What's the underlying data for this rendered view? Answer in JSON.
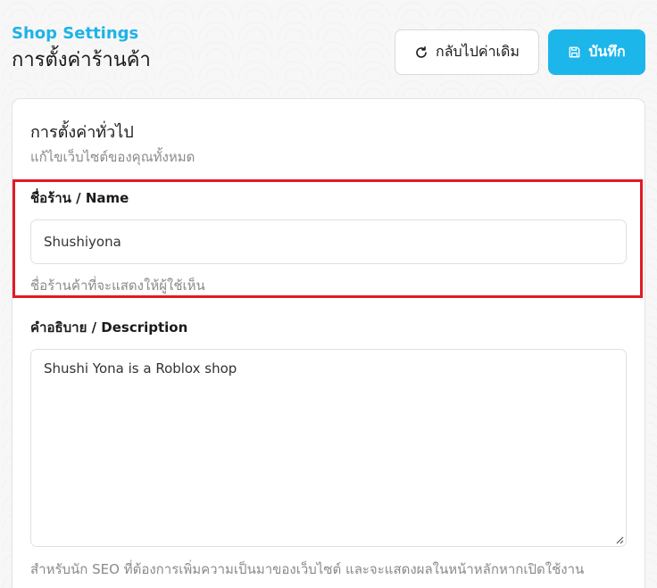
{
  "header": {
    "eyebrow": "Shop Settings",
    "title": "การตั้งค่าร้านค้า"
  },
  "actions": {
    "reset_label": "กลับไปค่าเดิม",
    "save_label": "บันทึก",
    "reset_icon": "refresh-icon",
    "save_icon": "save-icon"
  },
  "card": {
    "title": "การตั้งค่าทั่วไป",
    "subtitle": "แก้ไขเว็บไซต์ของคุณทั้งหมด"
  },
  "fields": {
    "name": {
      "label": "ชื่อร้าน / Name",
      "value": "Shushiyona",
      "help": "ชื่อร้านค้าที่จะแสดงให้ผู้ใช้เห็น"
    },
    "description": {
      "label": "คำอธิบาย / Description",
      "value": "Shushi Yona is a Roblox shop",
      "help": "สำหรับนัก SEO ที่ต้องการเพิ่มความเป็นมาของเว็บไซต์ และจะแสดงผลในหน้าหลักหากเปิดใช้งาน"
    }
  },
  "colors": {
    "accent": "#1cb6ea",
    "highlight": "#e01b24"
  }
}
